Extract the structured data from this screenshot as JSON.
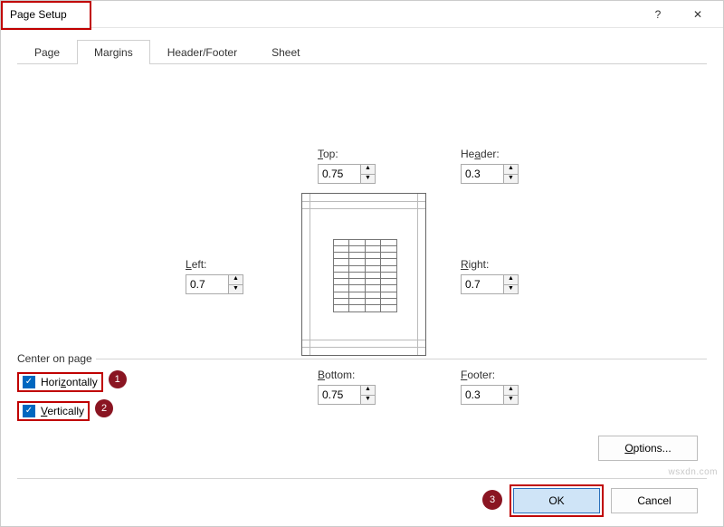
{
  "title": "Page Setup",
  "win": {
    "help": "?",
    "close": "✕"
  },
  "tabs": [
    {
      "label": "Page"
    },
    {
      "label": "Margins"
    },
    {
      "label": "Header/Footer"
    },
    {
      "label": "Sheet"
    }
  ],
  "active_tab": 1,
  "margins": {
    "top": {
      "label": "Top:",
      "value": "0.75"
    },
    "header": {
      "label": "Header:",
      "value": "0.3"
    },
    "left": {
      "label": "Left:",
      "value": "0.7"
    },
    "right": {
      "label": "Right:",
      "value": "0.7"
    },
    "bottom": {
      "label": "Bottom:",
      "value": "0.75"
    },
    "footer": {
      "label": "Footer:",
      "value": "0.3"
    }
  },
  "center_group": {
    "label": "Center on page",
    "horizontally": {
      "label": "Horizontally",
      "checked": true
    },
    "vertically": {
      "label": "Vertically",
      "checked": true
    }
  },
  "buttons": {
    "options": "Options...",
    "ok": "OK",
    "cancel": "Cancel"
  },
  "annotations": {
    "b1": "1",
    "b2": "2",
    "b3": "3"
  },
  "watermark": "wsxdn.com"
}
